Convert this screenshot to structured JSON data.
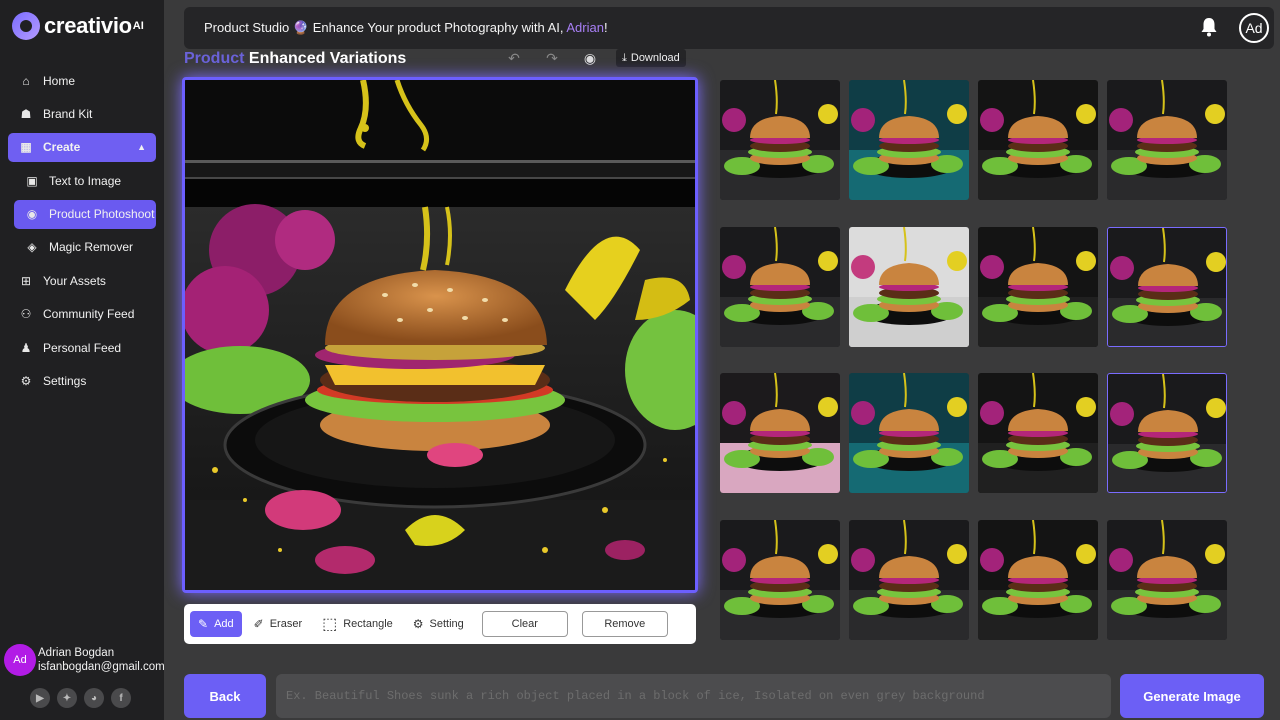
{
  "brand": {
    "name": "creativio",
    "ai": "AI"
  },
  "sidebar": {
    "items": [
      {
        "label": "Home",
        "icon": "home-icon"
      },
      {
        "label": "Brand Kit",
        "icon": "brand-kit-icon"
      },
      {
        "label": "Create",
        "icon": "grid-icon"
      },
      {
        "label": "Text to Image",
        "icon": "image-text-icon"
      },
      {
        "label": "Product Photoshoot",
        "icon": "photoshoot-icon"
      },
      {
        "label": "Magic Remover",
        "icon": "eraser-icon"
      },
      {
        "label": "Your Assets",
        "icon": "assets-icon"
      },
      {
        "label": "Community Feed",
        "icon": "community-icon"
      },
      {
        "label": "Personal Feed",
        "icon": "user-icon"
      },
      {
        "label": "Settings",
        "icon": "gear-icon"
      }
    ]
  },
  "user": {
    "initials": "Ad",
    "name": "Adrian Bogdan",
    "email": "isfanbogdan@gmail.com"
  },
  "socials": [
    "youtube-icon",
    "twitter-icon",
    "discord-icon",
    "facebook-icon"
  ],
  "header": {
    "prefix": "Product Studio",
    "emoji": "🔮",
    "text": " Enhance Your product Photography with AI, ",
    "name": "Adrian",
    "suffix": "!",
    "avatar": "Ad"
  },
  "title": {
    "accent": "Product",
    "rest": " Enhanced Variations"
  },
  "top_tools": {
    "download": "Download"
  },
  "toolbar": {
    "add": "Add",
    "eraser": "Eraser",
    "rectangle": "Rectangle",
    "setting": "Setting",
    "clear": "Clear",
    "remove": "Remove"
  },
  "grid": {
    "selected": [
      7,
      11
    ],
    "variants": [
      "pink",
      "teal",
      "plain",
      "pink",
      "pink",
      "white",
      "plain",
      "pink",
      "pinkfloor",
      "teal",
      "plain",
      "pink",
      "pink",
      "pink",
      "plain",
      "pink"
    ]
  },
  "bottom": {
    "back": "Back",
    "prompt_placeholder": "Ex. Beautiful Shoes sunk a rich object placed in a block of ice, Isolated on even grey background",
    "generate": "Generate Image"
  },
  "colors": {
    "accent": "#6c5ff5",
    "sidebar_bg": "#202022",
    "main_bg": "#3a3a3b",
    "name_highlight": "#a87ff5"
  }
}
